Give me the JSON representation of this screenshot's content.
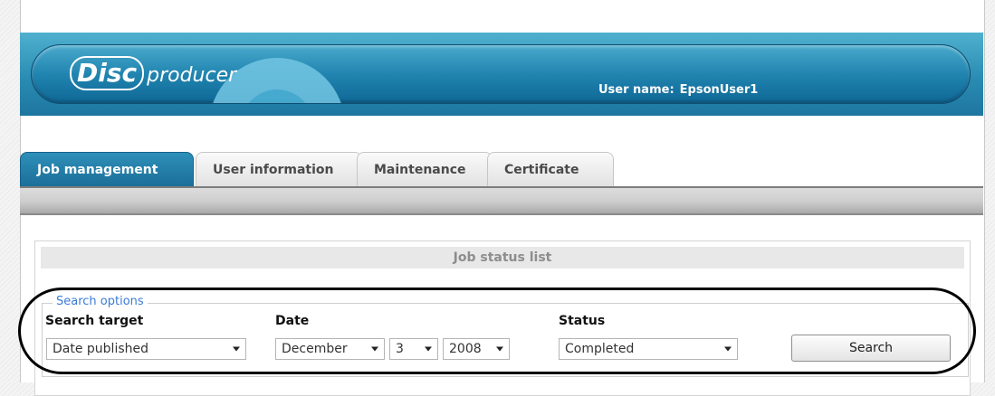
{
  "header": {
    "logo": {
      "word1": "Disc",
      "word2": "producer"
    },
    "user_label": "User name:",
    "user_name": "EpsonUser1"
  },
  "tabs": [
    {
      "label": "Job management",
      "active": true
    },
    {
      "label": "User information",
      "active": false
    },
    {
      "label": "Maintenance",
      "active": false
    },
    {
      "label": "Certificate",
      "active": false
    }
  ],
  "panel": {
    "title": "Job status list"
  },
  "search_options": {
    "legend": "Search options",
    "search_target": {
      "label": "Search target",
      "value": "Date published"
    },
    "date": {
      "label": "Date",
      "month": "December",
      "day": "3",
      "year": "2008"
    },
    "status": {
      "label": "Status",
      "value": "Completed"
    },
    "search_button": "Search"
  },
  "colors": {
    "header_blue": "#2185b0",
    "active_tab": "#1b6f99",
    "legend_blue": "#3b7bd4"
  }
}
